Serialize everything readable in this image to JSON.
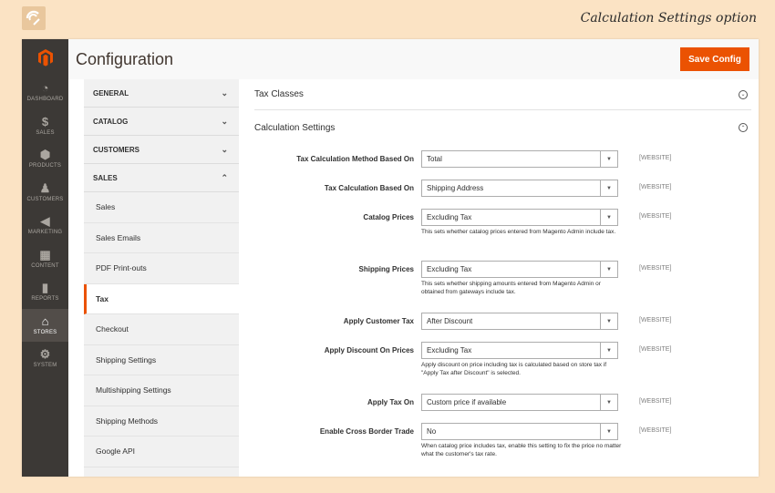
{
  "caption": "Calculation Settings option",
  "nav": {
    "items": [
      {
        "icon": "dashboard-icon",
        "glyph": "◔",
        "label": "DASHBOARD"
      },
      {
        "icon": "sales-icon",
        "glyph": "$",
        "label": "SALES"
      },
      {
        "icon": "products-icon",
        "glyph": "⬢",
        "label": "PRODUCTS"
      },
      {
        "icon": "customers-icon",
        "glyph": "♟",
        "label": "CUSTOMERS"
      },
      {
        "icon": "marketing-icon",
        "glyph": "◀",
        "label": "MARKETING"
      },
      {
        "icon": "content-icon",
        "glyph": "▦",
        "label": "CONTENT"
      },
      {
        "icon": "reports-icon",
        "glyph": "▮",
        "label": "REPORTS"
      },
      {
        "icon": "stores-icon",
        "glyph": "⌂",
        "label": "STORES"
      },
      {
        "icon": "system-icon",
        "glyph": "⚙",
        "label": "SYSTEM"
      }
    ]
  },
  "header": {
    "title": "Configuration",
    "save_label": "Save Config"
  },
  "tabs": {
    "groups": [
      {
        "label": "GENERAL",
        "chevron": "⌄"
      },
      {
        "label": "CATALOG",
        "chevron": "⌄"
      },
      {
        "label": "CUSTOMERS",
        "chevron": "⌄"
      },
      {
        "label": "SALES",
        "chevron": "⌃"
      }
    ],
    "sales_items": [
      "Sales",
      "Sales Emails",
      "PDF Print-outs",
      "Tax",
      "Checkout",
      "Shipping Settings",
      "Multishipping Settings",
      "Shipping Methods",
      "Google API"
    ],
    "active_item": "Tax"
  },
  "sections": {
    "tax_classes": {
      "title": "Tax Classes",
      "toggle": "⌄"
    },
    "calculation": {
      "title": "Calculation Settings",
      "toggle": "⌃"
    }
  },
  "fields": [
    {
      "label": "Tax Calculation Method Based On",
      "value": "Total",
      "scope": "[WEBSITE]",
      "note": ""
    },
    {
      "label": "Tax Calculation Based On",
      "value": "Shipping Address",
      "scope": "[WEBSITE]",
      "note": ""
    },
    {
      "label": "Catalog Prices",
      "value": "Excluding Tax",
      "scope": "[WEBSITE]",
      "note": "This sets whether catalog prices entered from Magento Admin include tax."
    },
    {
      "label": "Shipping Prices",
      "value": "Excluding Tax",
      "scope": "[WEBSITE]",
      "note": "This sets whether shipping amounts entered from Magento Admin or obtained from gateways include tax."
    },
    {
      "label": "Apply Customer Tax",
      "value": "After Discount",
      "scope": "[WEBSITE]",
      "note": ""
    },
    {
      "label": "Apply Discount On Prices",
      "value": "Excluding Tax",
      "scope": "[WEBSITE]",
      "note": "Apply discount on price including tax is calculated based on store tax if \"Apply Tax after Discount\" is selected."
    },
    {
      "label": "Apply Tax On",
      "value": "Custom price if available",
      "scope": "[WEBSITE]",
      "note": ""
    },
    {
      "label": "Enable Cross Border Trade",
      "value": "No",
      "scope": "[WEBSITE]",
      "note": "When catalog price includes tax, enable this setting to fix the price no matter what the customer's tax rate."
    }
  ],
  "colors": {
    "accent": "#eb5202",
    "nav_bg": "#3c3936",
    "page_bg": "#fbe3c4"
  }
}
